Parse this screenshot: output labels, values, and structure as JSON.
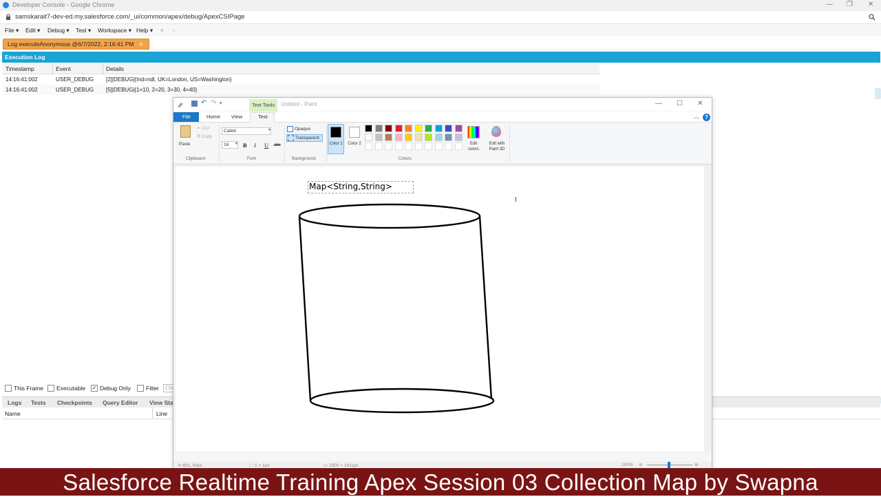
{
  "browser": {
    "title": "Developer Console - Google Chrome",
    "url": "samskarait7-dev-ed.my.salesforce.com/_ui/common/apex/debug/ApexCSIPage"
  },
  "devconsole": {
    "menu": [
      "File ▾",
      "Edit ▾",
      "Debug ▾",
      "Test ▾",
      "Workspace ▾",
      "Help ▾",
      "<",
      ">"
    ],
    "log_tab": "Log executeAnonymous @6/7/2022, 2:16:41 PM",
    "panel_title": "Execution Log",
    "columns": [
      "Timestamp",
      "Event",
      "Details"
    ],
    "rows": [
      {
        "timestamp": "14:16:41:002",
        "event": "USER_DEBUG",
        "details": "[2]|DEBUG|{Ind=ndl, UK=London, US=Washington}"
      },
      {
        "timestamp": "14:16:41:002",
        "event": "USER_DEBUG",
        "details": "[5]|DEBUG|{1=10, 2=20, 3=30, 4=40}"
      }
    ],
    "options": [
      {
        "label": "This Frame",
        "checked": false
      },
      {
        "label": "Executable",
        "checked": false
      },
      {
        "label": "Debug Only",
        "checked": true
      },
      {
        "label": "Filter",
        "checked": false
      }
    ],
    "filter_placeholder": "Clic",
    "lower_tabs": [
      "Logs",
      "Tests",
      "Checkpoints",
      "Query Editor",
      "View Sta"
    ],
    "lower_columns": [
      "Name",
      "Line"
    ]
  },
  "paint": {
    "title": "Untitled - Paint",
    "context_tab": "Text Tools",
    "tabs": [
      "File",
      "Home",
      "View",
      "Text"
    ],
    "clipboard": {
      "paste": "Paste",
      "cut": "Cut",
      "copy": "Copy",
      "label": "Clipboard"
    },
    "font": {
      "family": "Calibri",
      "size": "16",
      "label": "Font",
      "bold": "B",
      "italic": "I",
      "underline": "U",
      "strike": "abc"
    },
    "background": {
      "opaque": "Opaque",
      "transparent": "Transparent",
      "label": "Background"
    },
    "color1_label": "Color 1",
    "color2_label": "Color 2",
    "colors_label": "Colors",
    "edit_colors": "Edit colors",
    "edit_paint3d": "Edit with Paint 3D",
    "palette_row1": [
      "#000000",
      "#7f7f7f",
      "#880015",
      "#ed1c24",
      "#ff7f27",
      "#fff200",
      "#22b14c",
      "#00a2e8",
      "#3f48cc",
      "#a349a4"
    ],
    "palette_row2": [
      "#ffffff",
      "#c3c3c3",
      "#b97a57",
      "#ffaec9",
      "#ffc90e",
      "#efe4b0",
      "#b5e61d",
      "#99d9ea",
      "#7092be",
      "#c8bfe7"
    ],
    "canvas_text": "Map<String,String>",
    "status": {
      "position": "891, 90px",
      "selection": "1 × 1px",
      "size": "2500 × 1411px",
      "zoom": "100%"
    }
  },
  "caption": "Salesforce Realtime Training Apex Session 03 Collection Map by Swapna"
}
